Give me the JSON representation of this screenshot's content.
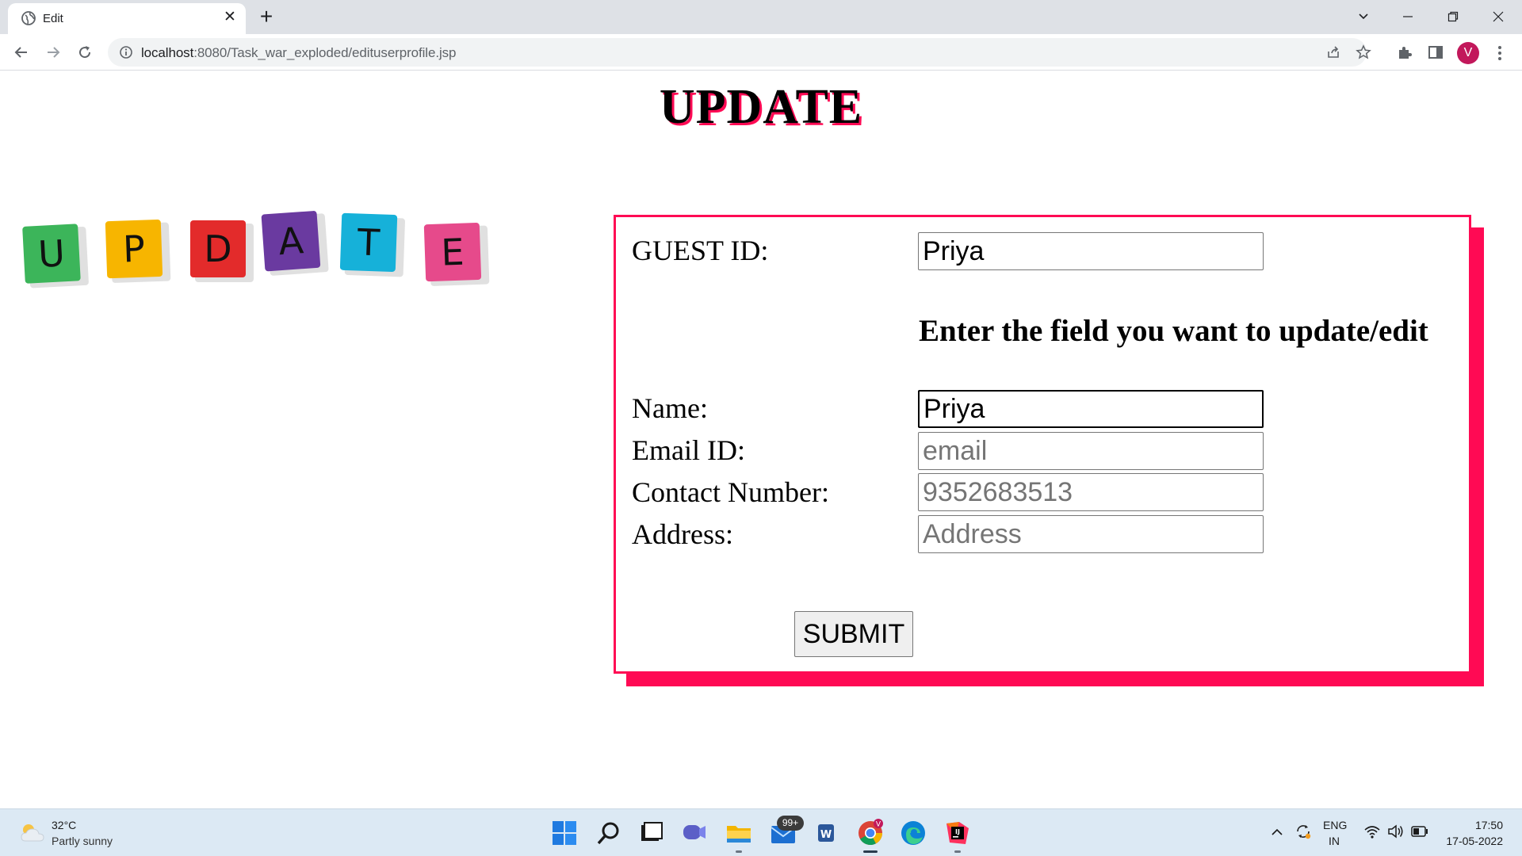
{
  "browser": {
    "tab_title": "Edit",
    "url_host": "localhost",
    "url_rest": ":8080/Task_war_exploded/edituserprofile.jsp",
    "profile_initial": "V"
  },
  "page": {
    "heading": "UPDATE",
    "blocks": [
      "U",
      "P",
      "D",
      "A",
      "T",
      "E"
    ],
    "block_colors": [
      "#3cb55a",
      "#f7b500",
      "#e32b2b",
      "#6a3aa0",
      "#16b1d9",
      "#e64a8b"
    ]
  },
  "form": {
    "guest_id_label": "GUEST ID:",
    "guest_id_value": "Priya",
    "instruction": "Enter the field you want to update/edit",
    "name_label": "Name:",
    "name_value": "Priya",
    "email_label": "Email ID:",
    "email_placeholder": "email",
    "contact_label": "Contact Number:",
    "contact_placeholder": "9352683513",
    "address_label": "Address:",
    "address_placeholder": "Address",
    "submit_label": "SUBMIT"
  },
  "colors": {
    "accent": "#ff0a54"
  },
  "taskbar": {
    "weather_temp": "32°C",
    "weather_desc": "Partly sunny",
    "mail_badge": "99+",
    "lang_top": "ENG",
    "lang_bottom": "IN",
    "time": "17:50",
    "date": "17-05-2022"
  }
}
